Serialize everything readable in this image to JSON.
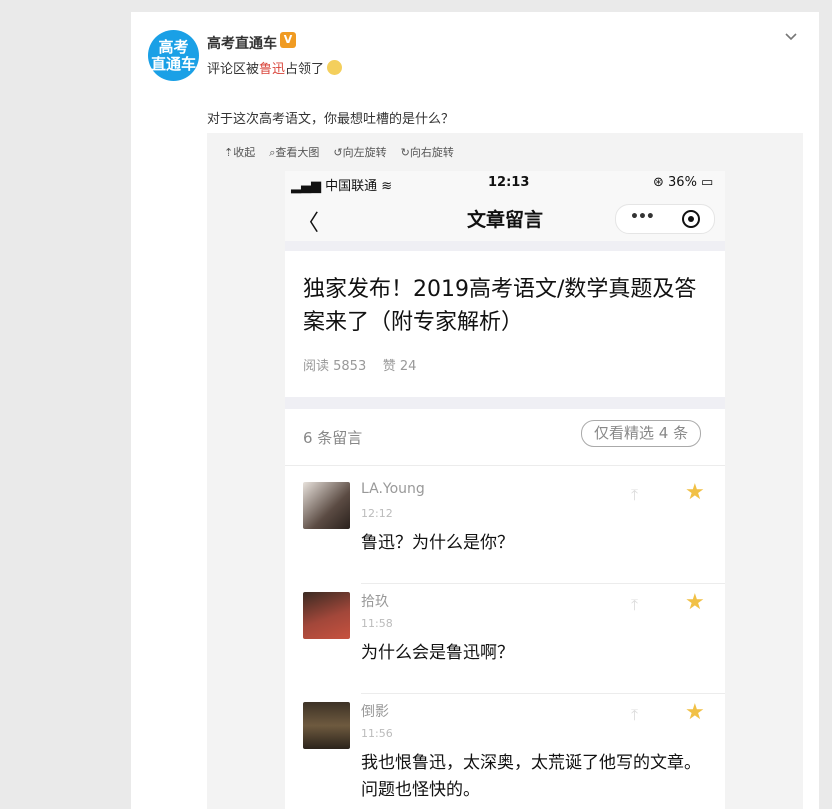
{
  "post": {
    "avatar_lines": [
      "高考",
      "直通车"
    ],
    "username": "高考直通车",
    "verified_badge": "V",
    "subtitle_before": "评论区被",
    "subtitle_highlight": "鲁迅",
    "subtitle_after": "占领了",
    "text": "对于这次高考语文，你最想吐槽的是什么？"
  },
  "toolbar": {
    "collapse": "⇡收起",
    "view_large": "⌕查看大图",
    "rotate_left": "↺向左旋转",
    "rotate_right": "↻向右旋转"
  },
  "phone": {
    "status": {
      "carrier": "▂▄▆ 中国联通 ≋",
      "time": "12:13",
      "battery": "⊛ 36% ▭"
    },
    "nav": {
      "back": "〈",
      "title": "文章留言",
      "more": "•••"
    },
    "article": {
      "headline": "独家发布！2019高考语文/数学真题及答案来了（附专家解析）",
      "reads": "阅读 5853",
      "likes": "赞 24"
    },
    "comments_header": {
      "count": "6 条留言",
      "filter": "仅看精选 4 条"
    },
    "comments": [
      {
        "name": "LA.Young",
        "time": "12:12",
        "text": "鲁迅？为什么是你？",
        "avatar_color": "#5b4b43"
      },
      {
        "name": "拾玖",
        "time": "11:58",
        "text": "为什么会是鲁迅啊？",
        "avatar_color": "#a2473a"
      },
      {
        "name": "倒影",
        "time": "11:56",
        "text": "我也恨鲁迅，太深奥，太荒诞了他写的文章。问题也怪快的。",
        "avatar_color": "#6e5a3f"
      }
    ]
  },
  "colors": {
    "highlight": "#d9453b",
    "star": "#f1c045",
    "logo": "#1aa0e6",
    "badge": "#f09b22"
  }
}
